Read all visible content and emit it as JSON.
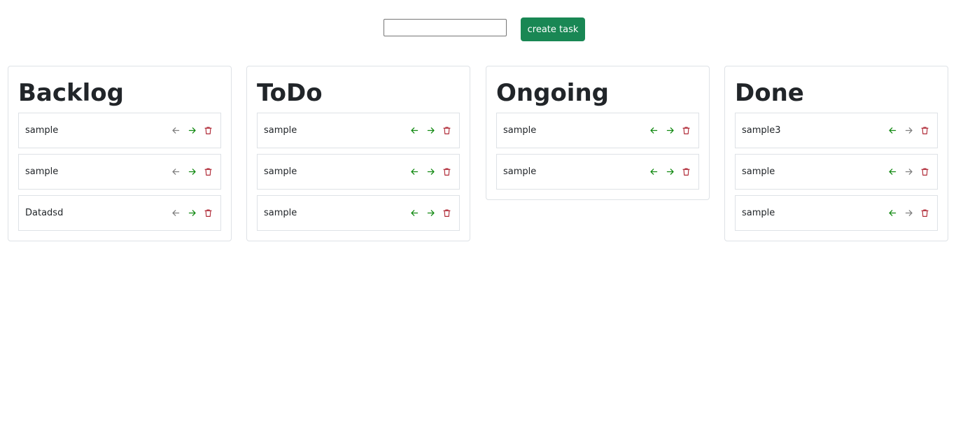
{
  "toolbar": {
    "input_value": "",
    "input_placeholder": "",
    "create_label": "create task"
  },
  "colors": {
    "enabled_arrow": "#138a13",
    "disabled_arrow": "#808080",
    "delete": "#b02a37",
    "button_bg": "#198754"
  },
  "columns": [
    {
      "title": "Backlog",
      "tasks": [
        {
          "label": "sample",
          "left": "disabled",
          "right": "enabled"
        },
        {
          "label": "sample",
          "left": "disabled",
          "right": "enabled"
        },
        {
          "label": "Datadsd",
          "left": "disabled",
          "right": "enabled"
        }
      ]
    },
    {
      "title": "ToDo",
      "tasks": [
        {
          "label": "sample",
          "left": "enabled",
          "right": "enabled"
        },
        {
          "label": "sample",
          "left": "enabled",
          "right": "enabled"
        },
        {
          "label": "sample",
          "left": "enabled",
          "right": "enabled"
        }
      ]
    },
    {
      "title": "Ongoing",
      "tasks": [
        {
          "label": "sample",
          "left": "enabled",
          "right": "enabled"
        },
        {
          "label": "sample",
          "left": "enabled",
          "right": "enabled"
        }
      ]
    },
    {
      "title": "Done",
      "tasks": [
        {
          "label": "sample3",
          "left": "enabled",
          "right": "disabled"
        },
        {
          "label": "sample",
          "left": "enabled",
          "right": "disabled"
        },
        {
          "label": "sample",
          "left": "enabled",
          "right": "disabled"
        }
      ]
    }
  ],
  "icons": {
    "left": "arrow-left-icon",
    "right": "arrow-right-icon",
    "delete": "trash-icon"
  }
}
